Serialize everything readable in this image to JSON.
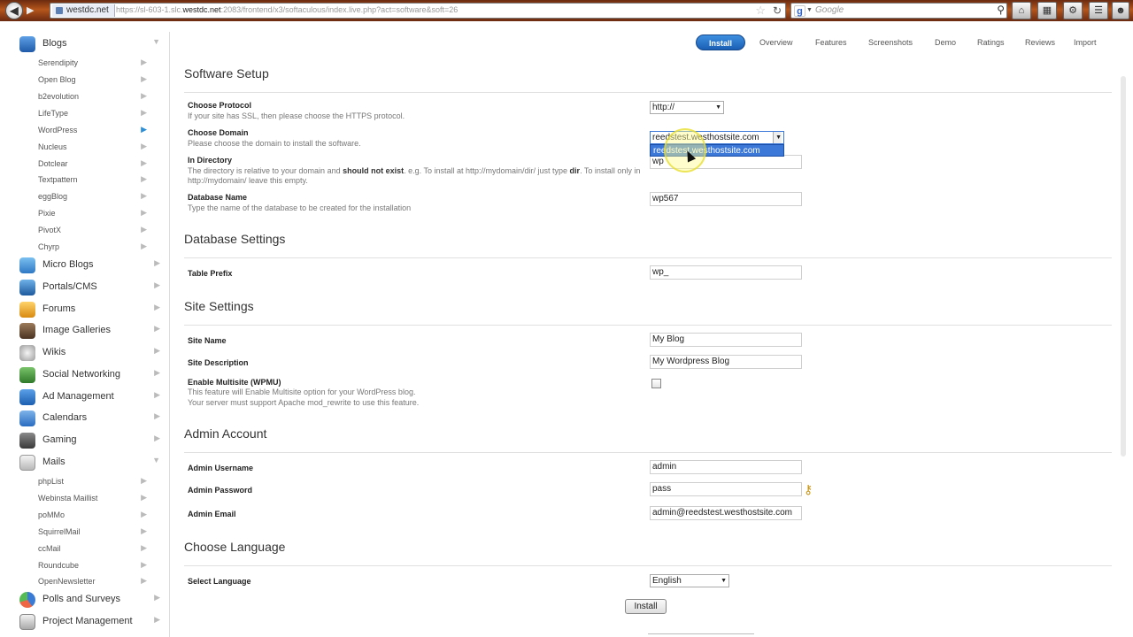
{
  "browser": {
    "site_badge": "westdc.net",
    "url_pre": "https://sl-603-1.slc.",
    "url_host": "westdc.net",
    "url_post": ":2083/frontend/x3/softaculous/index.live.php?act=software&soft=26",
    "search_placeholder": "Google"
  },
  "sidebar": {
    "blogs": {
      "label": "Blogs",
      "items": [
        "Serendipity",
        "Open Blog",
        "b2evolution",
        "LifeType",
        "WordPress",
        "Nucleus",
        "Dotclear",
        "Textpattern",
        "eggBlog",
        "Pixie",
        "PivotX",
        "Chyrp"
      ]
    },
    "categories": [
      "Micro Blogs",
      "Portals/CMS",
      "Forums",
      "Image Galleries",
      "Wikis",
      "Social Networking",
      "Ad Management",
      "Calendars",
      "Gaming"
    ],
    "mails": {
      "label": "Mails",
      "items": [
        "phpList",
        "Webinsta Maillist",
        "poMMo",
        "SquirrelMail",
        "ccMail",
        "Roundcube",
        "OpenNewsletter"
      ]
    },
    "bottom": [
      "Polls and Surveys",
      "Project Management"
    ]
  },
  "tabs": [
    "Install",
    "Overview",
    "Features",
    "Screenshots",
    "Demo",
    "Ratings",
    "Reviews",
    "Import"
  ],
  "software_setup": {
    "title": "Software Setup",
    "protocol_label": "Choose Protocol",
    "protocol_help": "If your site has SSL, then please choose the HTTPS protocol.",
    "protocol_value": "http://",
    "domain_label": "Choose Domain",
    "domain_help": "Please choose the domain to install the software.",
    "domain_value": "reedstest.westhostsite.com",
    "domain_option": "reedstest.westhostsite.com",
    "dir_label": "In Directory",
    "dir_help_1": "The directory is relative to your domain and ",
    "dir_help_bold1": "should not exist",
    "dir_help_2": ". e.g. To install at http://mydomain/dir/ just type ",
    "dir_help_bold2": "dir",
    "dir_help_3": ". To install only in http://mydomain/ leave this empty.",
    "dir_value": "wp",
    "db_label": "Database Name",
    "db_help": "Type the name of the database to be created for the installation",
    "db_value": "wp567"
  },
  "database_settings": {
    "title": "Database Settings",
    "prefix_label": "Table Prefix",
    "prefix_value": "wp_"
  },
  "site_settings": {
    "title": "Site Settings",
    "name_label": "Site Name",
    "name_value": "My Blog",
    "desc_label": "Site Description",
    "desc_value": "My Wordpress Blog",
    "multisite_label": "Enable Multisite (WPMU)",
    "multisite_help_1": "This feature will Enable Multisite option for your WordPress blog.",
    "multisite_help_2": "Your server must support Apache mod_rewrite to use this feature."
  },
  "admin_account": {
    "title": "Admin Account",
    "user_label": "Admin Username",
    "user_value": "admin",
    "pass_label": "Admin Password",
    "pass_value": "pass",
    "email_label": "Admin Email",
    "email_value": "admin@reedstest.westhostsite.com"
  },
  "language": {
    "title": "Choose Language",
    "label": "Select Language",
    "value": "English"
  },
  "install_button": "Install"
}
